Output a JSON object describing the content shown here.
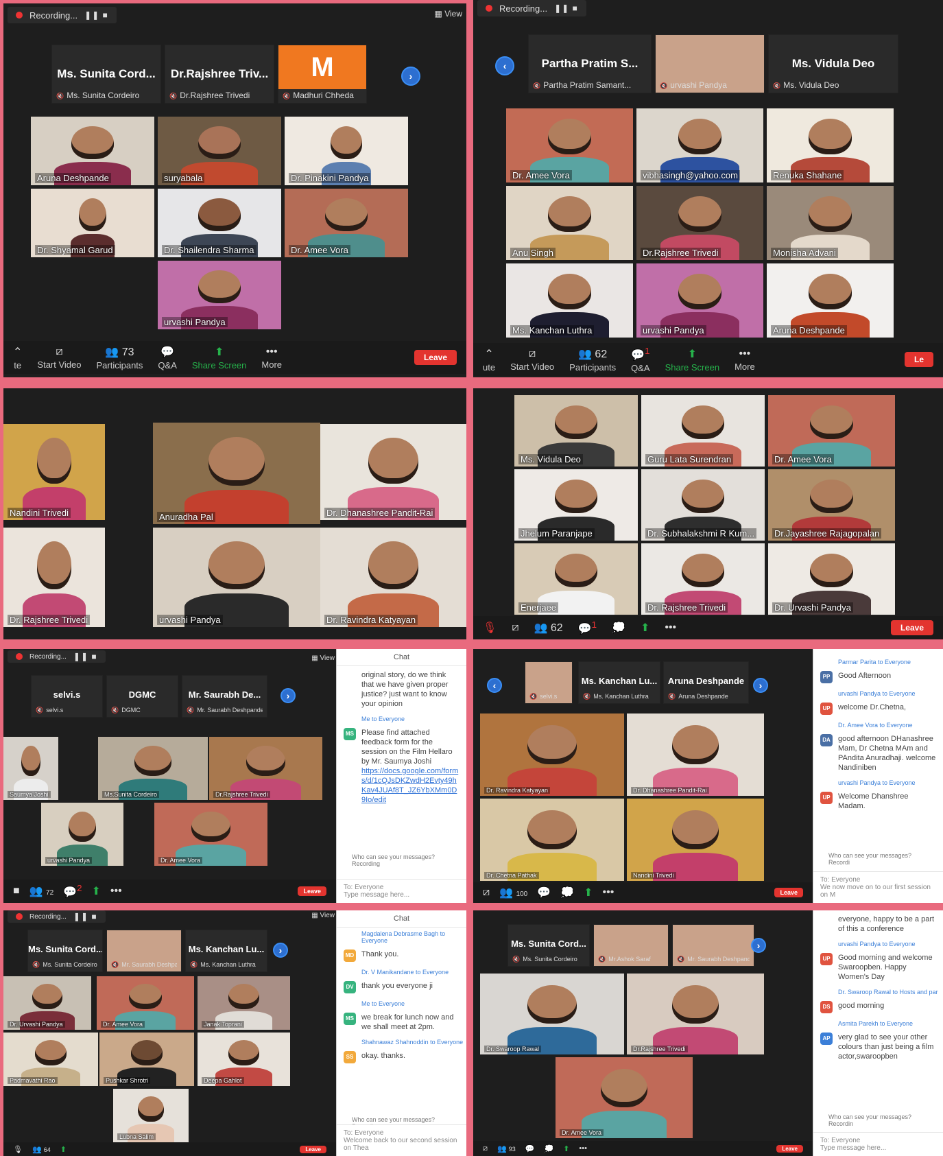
{
  "colors": {
    "divider": "#e96a7e",
    "panel_bg": "#1e1e1e",
    "active_border": "#e3e07a",
    "leave": "#e3342f",
    "share": "#26b24b",
    "nav": "#2d6fd0",
    "avatar_m": "#f07820"
  },
  "panel1": {
    "recording": "Recording...",
    "view": "View",
    "strip": [
      "Ms. Sunita Cord...",
      "Dr.Rajshree Triv...",
      "M"
    ],
    "strip_sub": [
      "Ms. Sunita Cordeiro",
      "Dr.Rajshree Trivedi",
      "Madhuri Chheda"
    ],
    "tiles": [
      "Aruna Deshpande",
      "suryabala",
      "Dr. Pinakini Pandya",
      "Dr. Shyamal Garud",
      "Dr. Shailendra Sharma",
      "Dr. Amee Vora",
      "urvashi Pandya"
    ],
    "toolbar": {
      "mute": "te",
      "video": "Start Video",
      "participants": "Participants",
      "count": "73",
      "qa": "Q&A",
      "share": "Share Screen",
      "more": "More",
      "leave": "Leave"
    }
  },
  "panel2": {
    "recording": "Recording...",
    "strip": [
      "Partha Pratim S...",
      "",
      "Ms. Vidula Deo"
    ],
    "strip_sub": [
      "Partha Pratim Samant...",
      "urvashi Pandya",
      "Ms. Vidula Deo"
    ],
    "tiles": [
      "Dr. Amee Vora",
      "vibhasingh@yahoo.com",
      "Renuka Shahane",
      "Anu Singh",
      "Dr.Rajshree Trivedi",
      "Monisha Advani",
      "Ms. Kanchan Luthra",
      "urvashi Pandya",
      "Aruna Deshpande"
    ],
    "toolbar": {
      "mute": "ute",
      "video": "Start Video",
      "participants": "Participants",
      "count": "62",
      "qa": "Q&A",
      "qa_badge": "1",
      "share": "Share Screen",
      "more": "More",
      "leave": "Le"
    }
  },
  "panel3": {
    "tiles": [
      "Nandini Trivedi",
      "Anuradha Pal",
      "Dr. Dhanashree Pandit-Rai",
      "Dr. Rajshree Trivedi",
      "urvashi Pandya",
      "Dr. Ravindra Katyayan"
    ]
  },
  "panel4": {
    "tiles": [
      "Ms. Vidula Deo",
      "Guru Lata Surendran",
      "Dr. Amee Vora",
      "Jhelum Paranjape",
      "Dr. Subhalakshmi R Kum...",
      "Dr.Jayashree Rajagopalan",
      "Enerjaee",
      "Dr. Rajshree Trivedi",
      "Dr. Urvashi Pandya"
    ],
    "toolbar": {
      "count": "62",
      "qa_badge": "1",
      "leave": "Leave"
    }
  },
  "panel5": {
    "recording": "Recording...",
    "view": "View",
    "strip": [
      "selvi.s",
      "DGMC",
      "Mr. Saurabh De..."
    ],
    "strip_sub": [
      "selvi.s",
      "DGMC",
      "Mr. Saurabh Deshpande"
    ],
    "tiles": [
      "Saumya Joshi",
      "Ms.Sunita Cordeiro",
      "Dr.Rajshree Trivedi",
      "urvashi Pandya",
      "Dr. Amee Vora"
    ],
    "toolbar": {
      "count": "72",
      "qa_badge": "2",
      "leave": "Leave"
    },
    "chat": {
      "title": "Chat",
      "text1": "original story, do we think that we have given proper justice? just want to know your opinion",
      "from2": "Me to Everyone",
      "text2": "Please find attached feedback form for the session on the Film Hellaro by Mr. Saumya Joshi",
      "link": "https://docs.google.com/forms/d/1cQJsDKZwdH2Evty49hKav4JUAf8T_JZ6YbXMm0D9Io/edit",
      "who": "Who can see your messages? Recording",
      "to": "To:",
      "to_val": "Everyone",
      "placeholder": "Type message here..."
    }
  },
  "panel6": {
    "strip": [
      "",
      "Ms. Kanchan Lu...",
      "Aruna Deshpande"
    ],
    "strip_sub": [
      "selvi.s",
      "Ms. Kanchan Luthra",
      "Aruna Deshpande"
    ],
    "tiles": [
      "Dr. Ravindra Katyayan",
      "Dr. Dhanashree Pandit-Rai",
      "Dr. Chetna Pathak",
      "Nandini Trivedi"
    ],
    "toolbar": {
      "count": "100",
      "leave": "Leave"
    },
    "chat": {
      "msgs": [
        {
          "from": "Parmar Parita to Everyone",
          "av": "PP",
          "color": "#4a6fa5",
          "text": "Good Afternoon"
        },
        {
          "from": "urvashi Pandya to Everyone",
          "av": "UP",
          "color": "#e0533f",
          "text": "welcome Dr.Chetna,"
        },
        {
          "from": "Dr. Amee Vora to Everyone",
          "av": "DA",
          "color": "#4a6fa5",
          "text": "good afternoon DHanashree Mam, Dr Chetna MAm and PAndita Anuradhaji. welcome Nandiniben"
        },
        {
          "from": "urvashi Pandya to Everyone",
          "av": "UP",
          "color": "#e0533f",
          "text": "Welcome Dhanshree Madam."
        }
      ],
      "who": "Who can see your messages? Recordi",
      "to": "To:",
      "to_val": "Everyone",
      "placeholder": "We now move on to our first session on M"
    }
  },
  "panel7": {
    "recording": "Recording...",
    "view": "View",
    "strip": [
      "Ms. Sunita Cord...",
      "",
      "Ms. Kanchan Lu..."
    ],
    "strip_sub": [
      "Ms. Sunita Cordeiro",
      "Mr. Saurabh Deshpande",
      "Ms. Kanchan Luthra"
    ],
    "tiles": [
      "Dr. Urvashi Pandya",
      "Dr. Amee Vora",
      "Janak Toprani",
      "Padmavathi Rao",
      "Pushkar Shrotri",
      "Deepa Gahlot",
      "Lubna Salim"
    ],
    "toolbar": {
      "count": "64",
      "leave": "Leave"
    },
    "chat": {
      "title": "Chat",
      "msgs": [
        {
          "from": "Magdalena Debrasme Bagh to Everyone",
          "av": "MD",
          "color": "#f2a93b",
          "text": "Thank you."
        },
        {
          "from": "Dr. V Manikandane to Everyone",
          "av": "DV",
          "color": "#36b37e",
          "text": "thank you everyone ji"
        },
        {
          "from": "Me to Everyone",
          "av": "MS",
          "color": "#36b37e",
          "text": "we break for lunch now and we shall meet at 2pm."
        },
        {
          "from": "Shahnawaz Shahnoddin to Everyone",
          "av": "SS",
          "color": "#f2a93b",
          "text": "okay. thanks."
        }
      ],
      "who": "Who can see your messages? Recording",
      "to": "To:",
      "to_val": "Everyone",
      "placeholder": "Welcome back to our second session on Thea"
    }
  },
  "panel8": {
    "strip": [
      "Ms. Sunita Cord...",
      "",
      ""
    ],
    "strip_sub": [
      "Ms. Sunita Cordeiro",
      "Mr.Ashok Saraf",
      "Mr. Saurabh Deshpande"
    ],
    "tiles": [
      "Dr. Swaroop Rawal",
      "Dr.Rajshree Trivedi",
      "Dr. Amee Vora"
    ],
    "toolbar": {
      "count": "93",
      "leave": "Leave"
    },
    "chat": {
      "top": "everyone, happy to be a part of this a conference",
      "msgs": [
        {
          "from": "urvashi Pandya to Everyone",
          "av": "UP",
          "color": "#e0533f",
          "text": "Good morning and welcome Swaroopben. Happy Women's Day"
        },
        {
          "from": "Dr. Swaroop Rawal to Hosts and par",
          "av": "DS",
          "color": "#e0533f",
          "text": "good morning"
        },
        {
          "from": "Asmita Parekh to Everyone",
          "av": "AP",
          "color": "#3b7fd8",
          "text": "very glad to see your other colours than just being a film actor,swaroopben"
        }
      ],
      "who": "Who can see your messages? Recordin",
      "to": "To:",
      "to_val": "Everyone",
      "placeholder": "Type message here..."
    }
  }
}
